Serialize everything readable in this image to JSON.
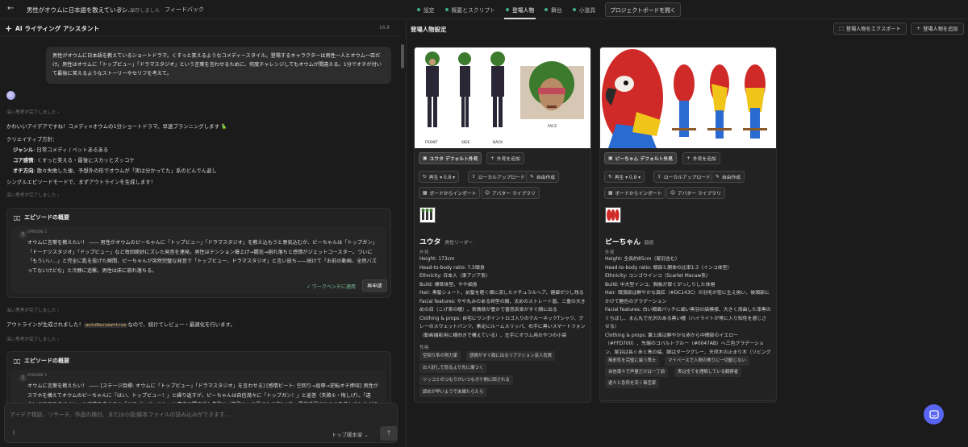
{
  "topbar": {
    "back_icon": "←",
    "title": "男性がオウムに日本語を教えているシ...",
    "saved": "保存しました",
    "feedback": "フィードバック"
  },
  "tabs": [
    {
      "label": "設定"
    },
    {
      "label": "概要とスクリプト"
    },
    {
      "label": "登場人物",
      "active": true
    },
    {
      "label": "舞台"
    },
    {
      "label": "小道具"
    }
  ],
  "open_board": "プロジェクトボードを開く",
  "assistant": {
    "title": "AI ライティング アシスタント",
    "version": "16.8",
    "user_message": "男性がオウムに日本語を教えているショートドラマ。くすっと笑えるようなコメディースタイル。登場するキャラクターは男性一人とオウム一匹だけ。男性はオウムに「トップビュー」「ドラマスタジオ」という言葉を言わせるために、何度チャレンジしてもオウムが間違える。1分でオチが付いて最後に笑えるようなストーリーやセリフを考えて。",
    "thinking1": "深い思考が完了しました ›",
    "reply_intro": "かわいいアイデアですね！コメディ×オウムの1分ショートドラマ、早速プランニングします 🦜",
    "policy_title": "クリエイティブ方針：",
    "policy": [
      {
        "k": "ジャンル",
        "v": ": 日常コメディ / ペットあるある"
      },
      {
        "k": "コア感情",
        "v": ": くすっと笑える・最後にスカッとズッコケ"
      },
      {
        "k": "オチ方向",
        "v": ": 散々失敗した後、予想外の形でオウムが「実は分かってた」系のどんでん返し"
      }
    ],
    "outline_note": "シングルエピソードモードで、まずアウトラインを生成します！",
    "thinking2": "深い思考が完了しました ›",
    "card1": {
      "title": "エピソードの概要",
      "num": "1",
      "ep_label": "EPISODE 1",
      "text": "オウムに言葉を教えたい！ ―― 男性がオウムのピーちゃんに「トップビュー」「ドラマスタジオ」を教え込もうと意気込むが、ピーちゃんは「トップガン」「ドーナツスタジオ」「ドップビュー」など毎回絶妙にズレた発音を連発。男性はテンション爆上げ→闘志→崩れ落ちと感情がジェットコースター。ついに「もういい…」と完全に匙を投げた瞬間、ピーちゃんが突然完璧な発音で「トップビュー、ドラマスタジオ」と言い放ち——続けて「お前の動画、全然バズってないけどな」と冷静に追撃。男性は床に崩れ落ちる。",
      "applied": "✓ ワークベンチに適用",
      "reapply": "再申請"
    },
    "thinking3": "深い思考が完了しました ›",
    "auto_pre": "アウトラインが生成されました！",
    "auto_code": "autoReview=true",
    "auto_post": "なので、続けてレビュー・最適化を行います。",
    "thinking4": "深い思考が完了しました ›",
    "card2": {
      "title": "エピソードの概要",
      "num": "1",
      "ep_label": "EPISODE 1",
      "text": "オウムに言葉を教えたい！ ―― [ステージ目標: オウムに「トップビュー」「ドラマスタジオ」を言わせる] [感情ビート: 空回り→屈辱→逆転オチ押収] 男性がスマホを構えてオウムのピーちゃんに「はい、トップビュー！」と繰り返すが、ピーちゃんは自信満々に「トップガン！」と返答（失敗①・悔しげ）。「違う！ドラマスタジオ！」と言葉を変えると「ドラゴンボール！」と素直に聞き返し失敗②（失敗②・お役にたつ悔しげ）。最終手段でおやつを差し出しながら懇願すると、ピー"
    },
    "composer_placeholder": "アイデア相談、リサーチ、作品の検討、または小説/脚本ファイルの読み込みができます...",
    "model": "トップ脚本家 ⌄",
    "send_icon": "↑"
  },
  "characters_panel": {
    "title": "登場人物設定",
    "export": "登場人物をエクスポート",
    "add": "登場人物を追加",
    "cards": [
      {
        "look": "ユウタ デフォルト外見",
        "add_look": "外見を追加",
        "regen": "再生 ▾ 0.8 ▾",
        "upload": "ローカルアップロード",
        "self_make": "自由作成",
        "import": "ボードからインポート",
        "avatar_lib": "アバター ライブラリ",
        "name": "ユウタ",
        "role": "男性リーダー",
        "appearance_label": "外見",
        "lines": [
          "Height: 173cm",
          "Head-to-body ratio: 7.5頭身",
          "Ethnicity: 日本人（東アジア系）",
          "Build: 標準体型、やや細身",
          "Hair: 黒髪ショート、前髪を軽く横に流したナチュラルヘア、寝癖が少し残る",
          "Facial features: やや丸みのある卵型の顔、太めのストレート眉、二重の大きめの目（こげ茶の瞳）、表情筋が豊かで喜怒哀楽がすぐ顔に出る",
          "Clothing & props: 自宅にワンポイントロゴ入りのクルーネックTシャツ、グレーのスウェットパンツ、素足にルームスリッパ、右手に黒いスマートフォン（動画撮影用に横向きで構えている）、左手にオウム用おやつの小袋"
        ],
        "traits_label": "性格",
        "traits": [
          "空回り系の努力家",
          "感情がすぐ顔に出るリアクション芸人気質",
          "お人好しで怒るより先に傷つく",
          "ツッコミのつもりがいつもボケ側に回される",
          "諦めが早いようで未練たらたら"
        ],
        "img_labels": [
          "FRONT",
          "SIDE",
          "BACK",
          "FACE"
        ]
      },
      {
        "look": "ピーちゃん デフォルト外見",
        "add_look": "外見を追加",
        "regen": "再生 ▾ 0.8 ▾",
        "upload": "ローカルアップロード",
        "self_make": "自由作成",
        "import": "ボードからインポート",
        "avatar_lib": "アバター ライブラリ",
        "name": "ピーちゃん",
        "role": "脇役",
        "appearance_label": "外見",
        "lines": [
          "Height: 全長約85cm（尾羽含む）",
          "Head-to-body ratio: 頭部と胴体の比率1:3（インコ体型）",
          "Ethnicity: コンゴウインコ（Scarlet Macaw系）",
          "Build: 中大型インコ、胸板が厚くがっしりした体格",
          "Hair: 頭頂部は鮮やかな真紅（#DC143C）の羽毛が密に生え揃い、後頭部にかけて艶色のグラデーション",
          "Facial features: 白い顔面パッチに細い黒羽の縞模様、大きく湾曲した漆黒のくちばし、まん丸で光沢のある黒い瞳（ハイライトが常に入り知性を感じさせる）",
          "Clothing & props: 翼上面は鮮やかな赤から中間部のイエロー（#FFD700）、先端のコバルトブルー（#0047AB）へ三色グラデーション、尾羽は長く赤と青の縞、脚はダークグレー、天然木の止まり木（リビングのテーブル横に設置）に堂々と胸を張って止まっている"
        ],
        "traits_label": "性格",
        "traits": [
          "無邪気を完璧に装う策士",
          "マイペースで人間の焦りに一切動じない",
          "自信満々で声量だけは一丁前",
          "実は全てを理解している観察者",
          "遊々と急所を突く毒舌家"
        ]
      }
    ]
  }
}
